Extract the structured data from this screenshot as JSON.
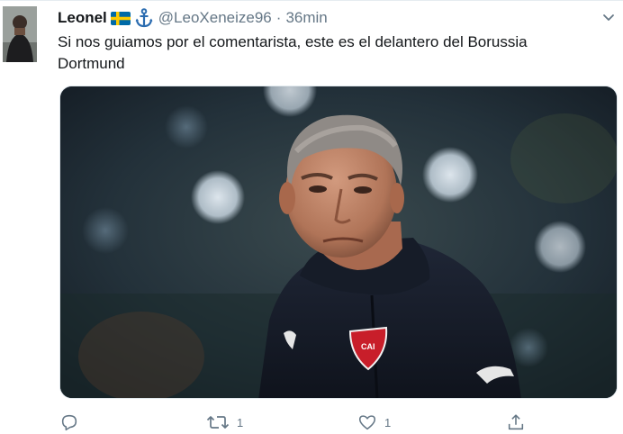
{
  "author": {
    "name": "Leonel",
    "handle": "@LeoXeneize96",
    "separator": "·",
    "time": "36min",
    "flag_icon": "sweden-flag-icon",
    "emoji_icon": "anchor-icon"
  },
  "tweet": {
    "text": "Si nos guiamos por el comentarista, este es el delantero del Borussia Dortmund"
  },
  "actions": {
    "reply": {
      "icon": "reply-icon",
      "count": ""
    },
    "retweet": {
      "icon": "retweet-icon",
      "count": "1"
    },
    "like": {
      "icon": "heart-icon",
      "count": "1"
    },
    "share": {
      "icon": "share-icon",
      "count": ""
    }
  },
  "colors": {
    "text": "#14171a",
    "secondary": "#657786",
    "link_blue": "#1da1f2",
    "border": "#e6ecf0"
  }
}
